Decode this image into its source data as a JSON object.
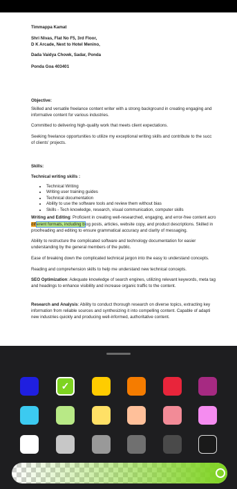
{
  "document": {
    "address": {
      "name": "Timmappa Kamat",
      "line1": "Shri Nivas, Flat No F5, 3rd Floor,",
      "line2": "D K Arcade, Next to Hotel Menino,",
      "line3": "Dada Vaidya Chowk, Sadar, Ponda",
      "line4": "Ponda Goa 403401"
    },
    "objective_heading": "Objective:",
    "objective_p1a": "Skilled and versatile freelance content writer with a strong background in creating engaging and",
    "objective_p1b": "informative content for various industries.",
    "objective_p2": "Committed to delivering high-quality work that meets client expectations.",
    "objective_p3a": "Seeking freelance opportunities to utilize my exceptional writing skills and contribute to the succ",
    "objective_p3b": "of clients' projects.",
    "skills_heading": "Skills:",
    "technical_heading": "Technical writing skills :",
    "technical_items": [
      "Technical Writing",
      "Writing user training guides",
      "Technical documentation",
      "Ability to use the software tools and review them without bias",
      "Skills - Tech knowledge, research, visual communication, computer skills"
    ],
    "writing_label": "Writing and Editing",
    "writing_line1": ": Proficient in creating well-researched, engaging, and error-free content acro",
    "writing_hl_orange": "diff",
    "writing_hl_green": "erent formats, including b",
    "writing_line2_rest": "log posts, articles, website copy, and product descriptions. Skilled in",
    "writing_line3": "proofreading and editing to ensure grammatical accuracy and clarity of messaging.",
    "restructure_a": "Ability to restructure the complicated software and technology documentation for easier",
    "restructure_b": "understanding by the general members of the public.",
    "ease": "Ease of breaking down the complicated technical jargon into the easy to understand concepts.",
    "reading": "Reading and comprehension skills to help me understand new technical concepts.",
    "seo_label": "SEO Optimization",
    "seo_a": ": Adequate knowledge of  search engines, utilizing relevant keywords, meta tag",
    "seo_b": "and headings to enhance visibility and increase organic traffic to the content.",
    "research_label": "Research and Analysis",
    "research_a": ": Ability to conduct thorough research on diverse topics, extracting key",
    "research_b": "information from reliable sources and synthesizing it into compelling content. Capable of adapti",
    "research_c": "new industries quickly and producing well-informed, authoritative content."
  },
  "color_picker": {
    "selected_index": 1,
    "check_glyph": "✓",
    "rows": [
      [
        "#1f1fe0",
        "#7ed321",
        "#ffcc00",
        "#f57c00",
        "#e8253b",
        "#a62a82"
      ],
      [
        "#3ccaf0",
        "#b8e986",
        "#ffe066",
        "#ffc09a",
        "#f28b97",
        "#f58cf0"
      ],
      [
        "#ffffff",
        "#c7c7c7",
        "#999999",
        "#707070",
        "#4a4a4a",
        "#1a1a1a"
      ]
    ],
    "opacity_color": "#7ed321",
    "opacity": 1.0
  }
}
